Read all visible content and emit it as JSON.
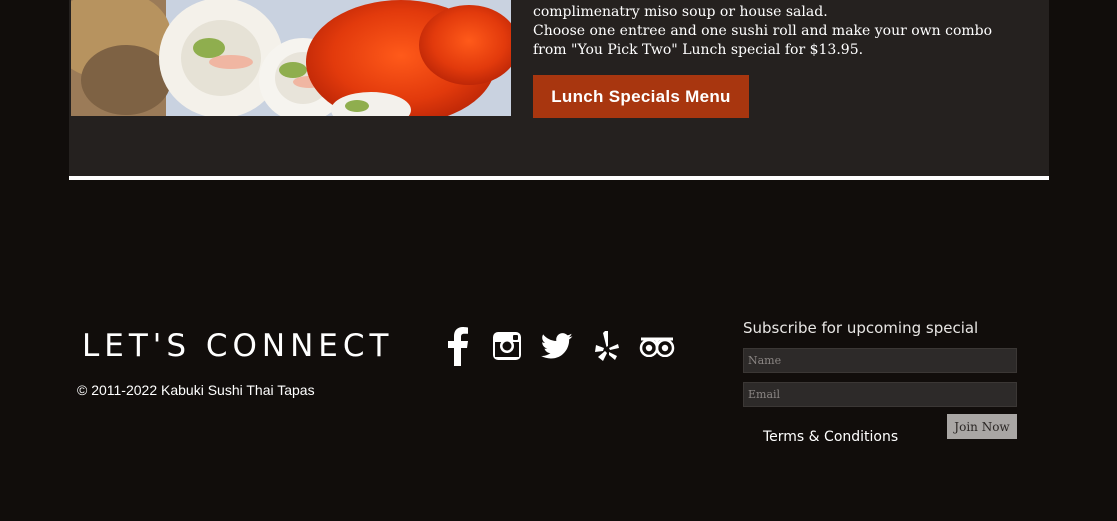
{
  "lunch": {
    "text_line_1": "complimenatry miso soup or house salad.",
    "text_line_2": "Choose one entree and one sushi roll and make your own combo",
    "text_line_3": "from \"You Pick Two\" Lunch special for $13.95.",
    "button_label": "Lunch Specials Menu"
  },
  "footer": {
    "connect_title": "LET'S CONNECT",
    "copyright": "© 2011-2022 Kabuki Sushi Thai Tapas",
    "social_icons": [
      "facebook-icon",
      "instagram-icon",
      "twitter-icon",
      "yelp-icon",
      "tripadvisor-icon"
    ]
  },
  "subscribe": {
    "title": "Subscribe for upcoming special",
    "name_placeholder": "Name",
    "email_placeholder": "Email",
    "join_label": "Join Now",
    "terms_label": "Terms & Conditions"
  },
  "colors": {
    "page_background": "#110d0b",
    "panel_background": "#25211f",
    "button_accent": "#a8360f",
    "join_button": "#a9a6a4"
  }
}
